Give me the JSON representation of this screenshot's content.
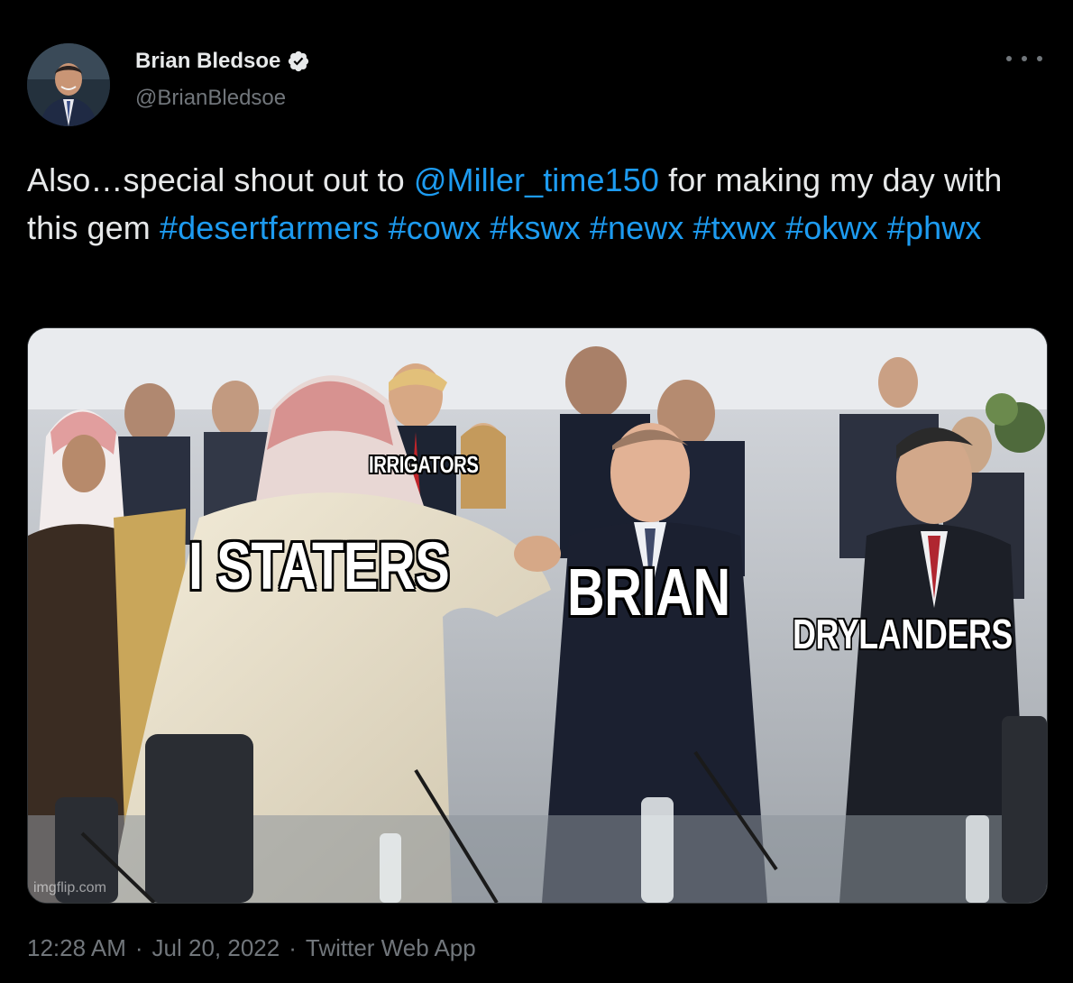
{
  "author": {
    "name": "Brian Bledsoe",
    "handle": "@BrianBledsoe",
    "verified": true,
    "avatar_icon": "avatar-photo-icon"
  },
  "tweet": {
    "text_plain_1": "Also…special shout out to ",
    "mention": "@Miller_time150",
    "text_plain_2": " for making my day with this gem ",
    "hashtags": [
      "#desertfarmers",
      "#cowx",
      "#kswx",
      "#newx",
      "#txwx",
      "#okwx",
      "#phwx"
    ]
  },
  "media": {
    "captions": {
      "irrigators": "IRRIGATORS",
      "istaters": "I STATERS",
      "brian": "BRIAN",
      "drylanders": "DRYLANDERS"
    },
    "watermark": "imgflip.com"
  },
  "footer": {
    "time": "12:28 AM",
    "date": "Jul 20, 2022",
    "separator": "·",
    "source": "Twitter Web App"
  },
  "colors": {
    "background": "#000000",
    "text": "#e7e9ea",
    "secondary": "#71767b",
    "link": "#1d9bf0",
    "verified_badge": "#e7e9ea"
  }
}
